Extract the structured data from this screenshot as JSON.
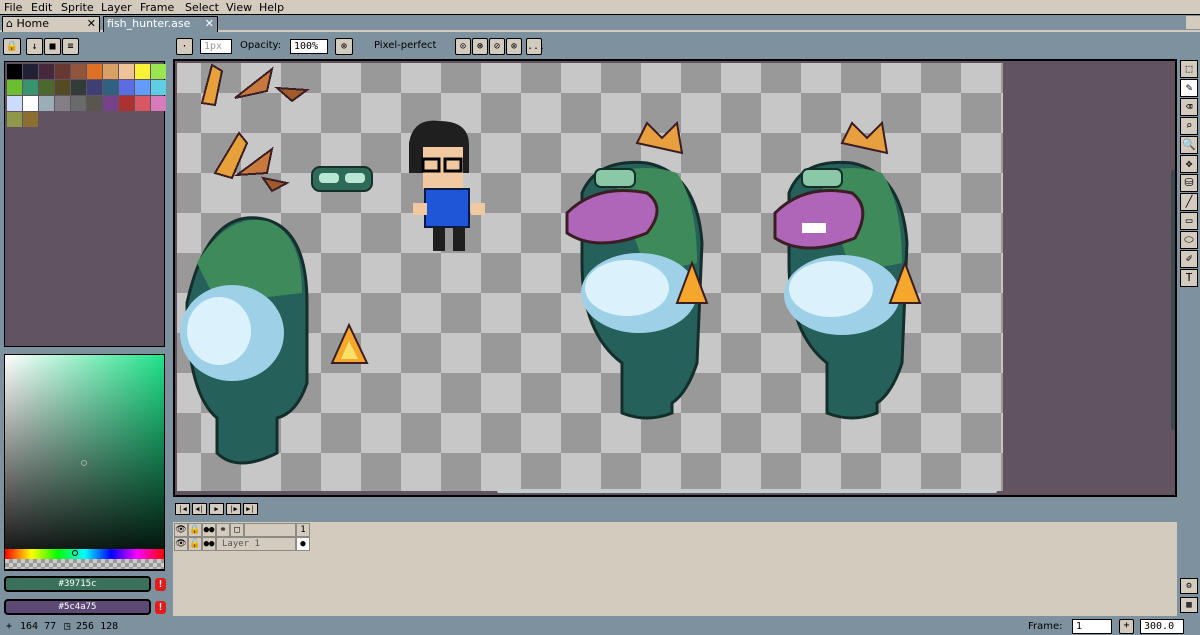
{
  "menu": [
    "File",
    "Edit",
    "Sprite",
    "Layer",
    "Frame",
    "Select",
    "View",
    "Help"
  ],
  "tabs": {
    "home": {
      "label": "Home",
      "close": "✕"
    },
    "file": {
      "label": "fish_hunter.ase",
      "close": "✕"
    }
  },
  "context": {
    "brush_size": "1px",
    "opacity_label": "Opacity:",
    "opacity_value": "100%",
    "pixel_perfect_label": "Pixel-perfect",
    "more": "..."
  },
  "palette": {
    "colors": [
      "#000000",
      "#222034",
      "#45283c",
      "#663931",
      "#8f563b",
      "#df7126",
      "#d9a066",
      "#eec39a",
      "#fbf236",
      "#99e550",
      "#6abe30",
      "#37946e",
      "#4b692f",
      "#524b24",
      "#323c39",
      "#3f3f74",
      "#306082",
      "#5b6ee1",
      "#639bff",
      "#5fcde4",
      "#cbdbfc",
      "#ffffff",
      "#9badb7",
      "#847e87",
      "#696a6a",
      "#595652",
      "#76428a",
      "#ac3232",
      "#d95763",
      "#d77bba",
      "#8f974a",
      "#8a6f30"
    ]
  },
  "colors": {
    "foreground": "#39715c",
    "background": "#5c4a75",
    "foreground_text": "#39715c",
    "background_text": "#5c4a75",
    "warn": "!"
  },
  "timeline": {
    "frame_header": "1",
    "layer_name": "Layer 1"
  },
  "status": {
    "cursor": "164 77",
    "size": "256 128",
    "frame_label": "Frame:",
    "frame_value": "1",
    "zoom": "300.0",
    "plus": "+"
  },
  "tools": [
    "marquee-icon",
    "pencil-icon",
    "eraser-icon",
    "eyedropper-icon",
    "zoom-icon",
    "move-icon",
    "bucket-icon",
    "line-icon",
    "rectangle-icon",
    "ellipse-icon",
    "brush-icon",
    "text-icon"
  ]
}
